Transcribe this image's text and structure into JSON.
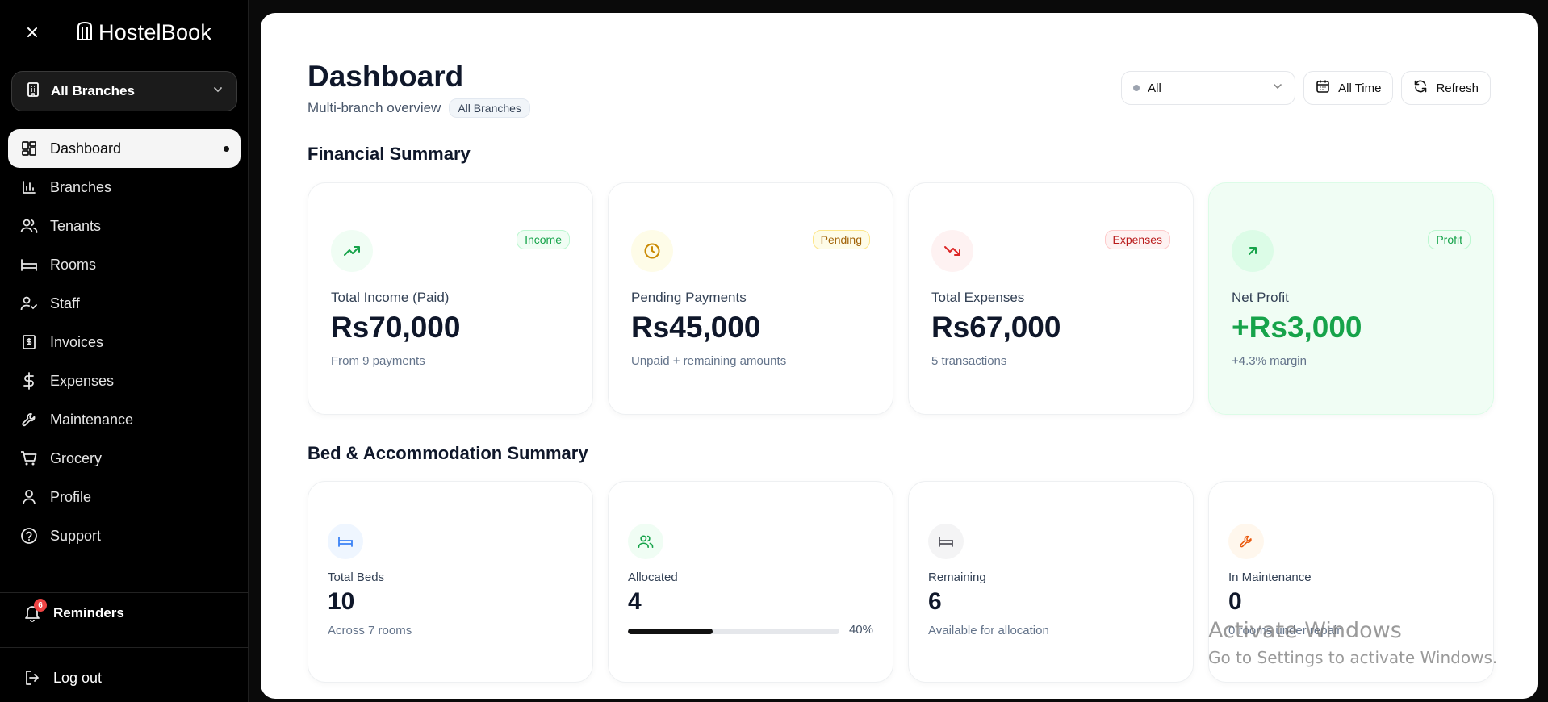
{
  "app": {
    "name": "HostelBook"
  },
  "sidebar": {
    "branch_select": "All Branches",
    "items": [
      {
        "label": "Dashboard",
        "icon": "dashboard-icon",
        "active": true
      },
      {
        "label": "Branches",
        "icon": "bar-chart-icon"
      },
      {
        "label": "Tenants",
        "icon": "users-icon"
      },
      {
        "label": "Rooms",
        "icon": "bed-icon"
      },
      {
        "label": "Staff",
        "icon": "user-check-icon"
      },
      {
        "label": "Invoices",
        "icon": "invoice-icon"
      },
      {
        "label": "Expenses",
        "icon": "dollar-icon"
      },
      {
        "label": "Maintenance",
        "icon": "wrench-icon"
      },
      {
        "label": "Grocery",
        "icon": "cart-icon"
      },
      {
        "label": "Profile",
        "icon": "user-icon"
      },
      {
        "label": "Support",
        "icon": "help-icon"
      }
    ],
    "reminders": {
      "label": "Reminders",
      "count": "6"
    },
    "logout": "Log out"
  },
  "header": {
    "title": "Dashboard",
    "subtitle": "Multi-branch overview",
    "chip": "All Branches",
    "filter_value": "All",
    "time_button": "All Time",
    "refresh_button": "Refresh"
  },
  "financial": {
    "title": "Financial Summary",
    "cards": [
      {
        "tag": "Income",
        "label": "Total Income (Paid)",
        "value": "Rs70,000",
        "sub": "From 9 payments",
        "icon": "trending-up-icon"
      },
      {
        "tag": "Pending",
        "label": "Pending Payments",
        "value": "Rs45,000",
        "sub": "Unpaid + remaining amounts",
        "icon": "clock-icon"
      },
      {
        "tag": "Expenses",
        "label": "Total Expenses",
        "value": "Rs67,000",
        "sub": "5 transactions",
        "icon": "trending-down-icon"
      },
      {
        "tag": "Profit",
        "label": "Net Profit",
        "value": "+Rs3,000",
        "sub": "+4.3% margin",
        "icon": "arrow-up-right-icon"
      }
    ]
  },
  "beds": {
    "title": "Bed & Accommodation Summary",
    "cards": [
      {
        "label": "Total Beds",
        "value": "10",
        "sub": "Across 7 rooms",
        "icon": "bed-icon"
      },
      {
        "label": "Allocated",
        "value": "4",
        "progress": 40,
        "progress_label": "40%",
        "icon": "users-icon"
      },
      {
        "label": "Remaining",
        "value": "6",
        "sub": "Available for allocation",
        "icon": "bed-icon"
      },
      {
        "label": "In Maintenance",
        "value": "0",
        "sub": "0 rooms under repair",
        "icon": "wrench-icon"
      }
    ]
  },
  "watermark": {
    "line1": "Activate Windows",
    "line2": "Go to Settings to activate Windows."
  },
  "colors": {
    "income": "#16a34a",
    "pending": "#ca8a04",
    "expenses": "#dc2626",
    "profit": "#16a34a",
    "accent_blue": "#3b82f6"
  }
}
